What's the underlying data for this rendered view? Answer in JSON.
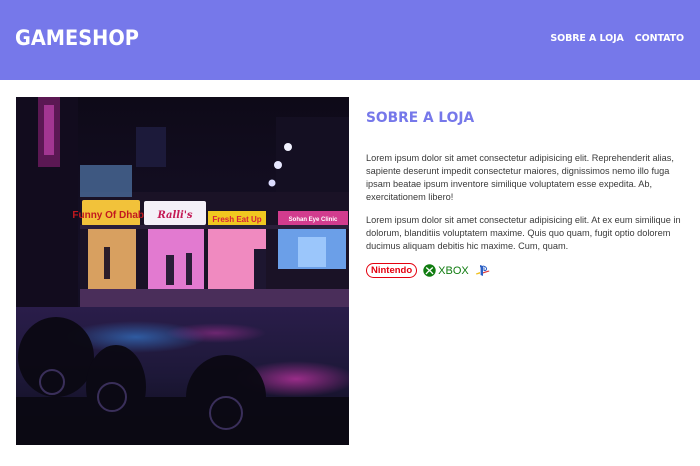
{
  "header": {
    "logo": "GAMESHOP",
    "nav": [
      {
        "label": "SOBRE A LOJA"
      },
      {
        "label": "CONTATO"
      }
    ]
  },
  "main": {
    "title": "SOBRE A LOJA",
    "paragraphs": [
      "Lorem ipsum dolor sit amet consectetur adipisicing elit. Reprehenderit alias, sapiente deserunt impedit consectetur maiores, dignissimos nemo illo fuga ipsam beatae ipsum inventore similique voluptatem esse expedita. Ab, exercitationem libero!",
      "Lorem ipsum dolor sit amet consectetur adipisicing elit. At ex eum similique in dolorum, blanditiis voluptatem maxime. Quis quo quam, fugit optio dolorem ducimus aliquam debitis hic maxime. Cum, quam."
    ],
    "brands": {
      "nintendo": "Nintendo",
      "xbox": "XBOX"
    },
    "photo_signs": [
      "Funny Of Dhaba",
      "Ralli's",
      "Fresh Eat Up",
      "Sohan Eye Clinic"
    ]
  },
  "colors": {
    "header_bg": "#7678ea",
    "accent": "#7678ea",
    "nintendo": "#e4000f",
    "xbox": "#107c10"
  }
}
